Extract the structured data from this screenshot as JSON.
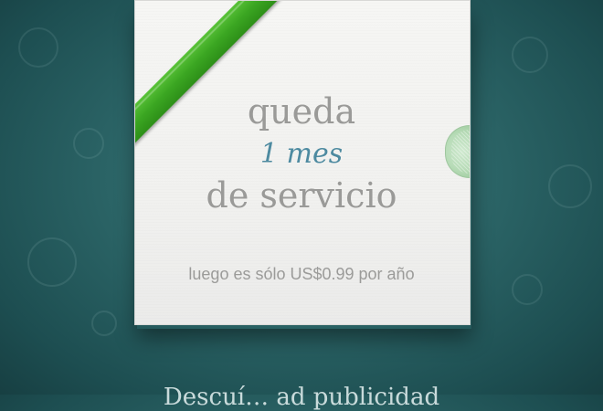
{
  "card": {
    "line1": "queda",
    "line2": "1 mes",
    "line3": "de servicio",
    "subtext": "luego es sólo US$0.99 por año"
  },
  "footer": {
    "text": "Descuí…      ad publicidad"
  },
  "colors": {
    "background": "#2b6466",
    "ribbon": "#3ba622",
    "accent_text": "#4d8aa0",
    "card": "#f3f3f1"
  },
  "icons": [
    "ribbon-icon",
    "card-tab-icon"
  ]
}
